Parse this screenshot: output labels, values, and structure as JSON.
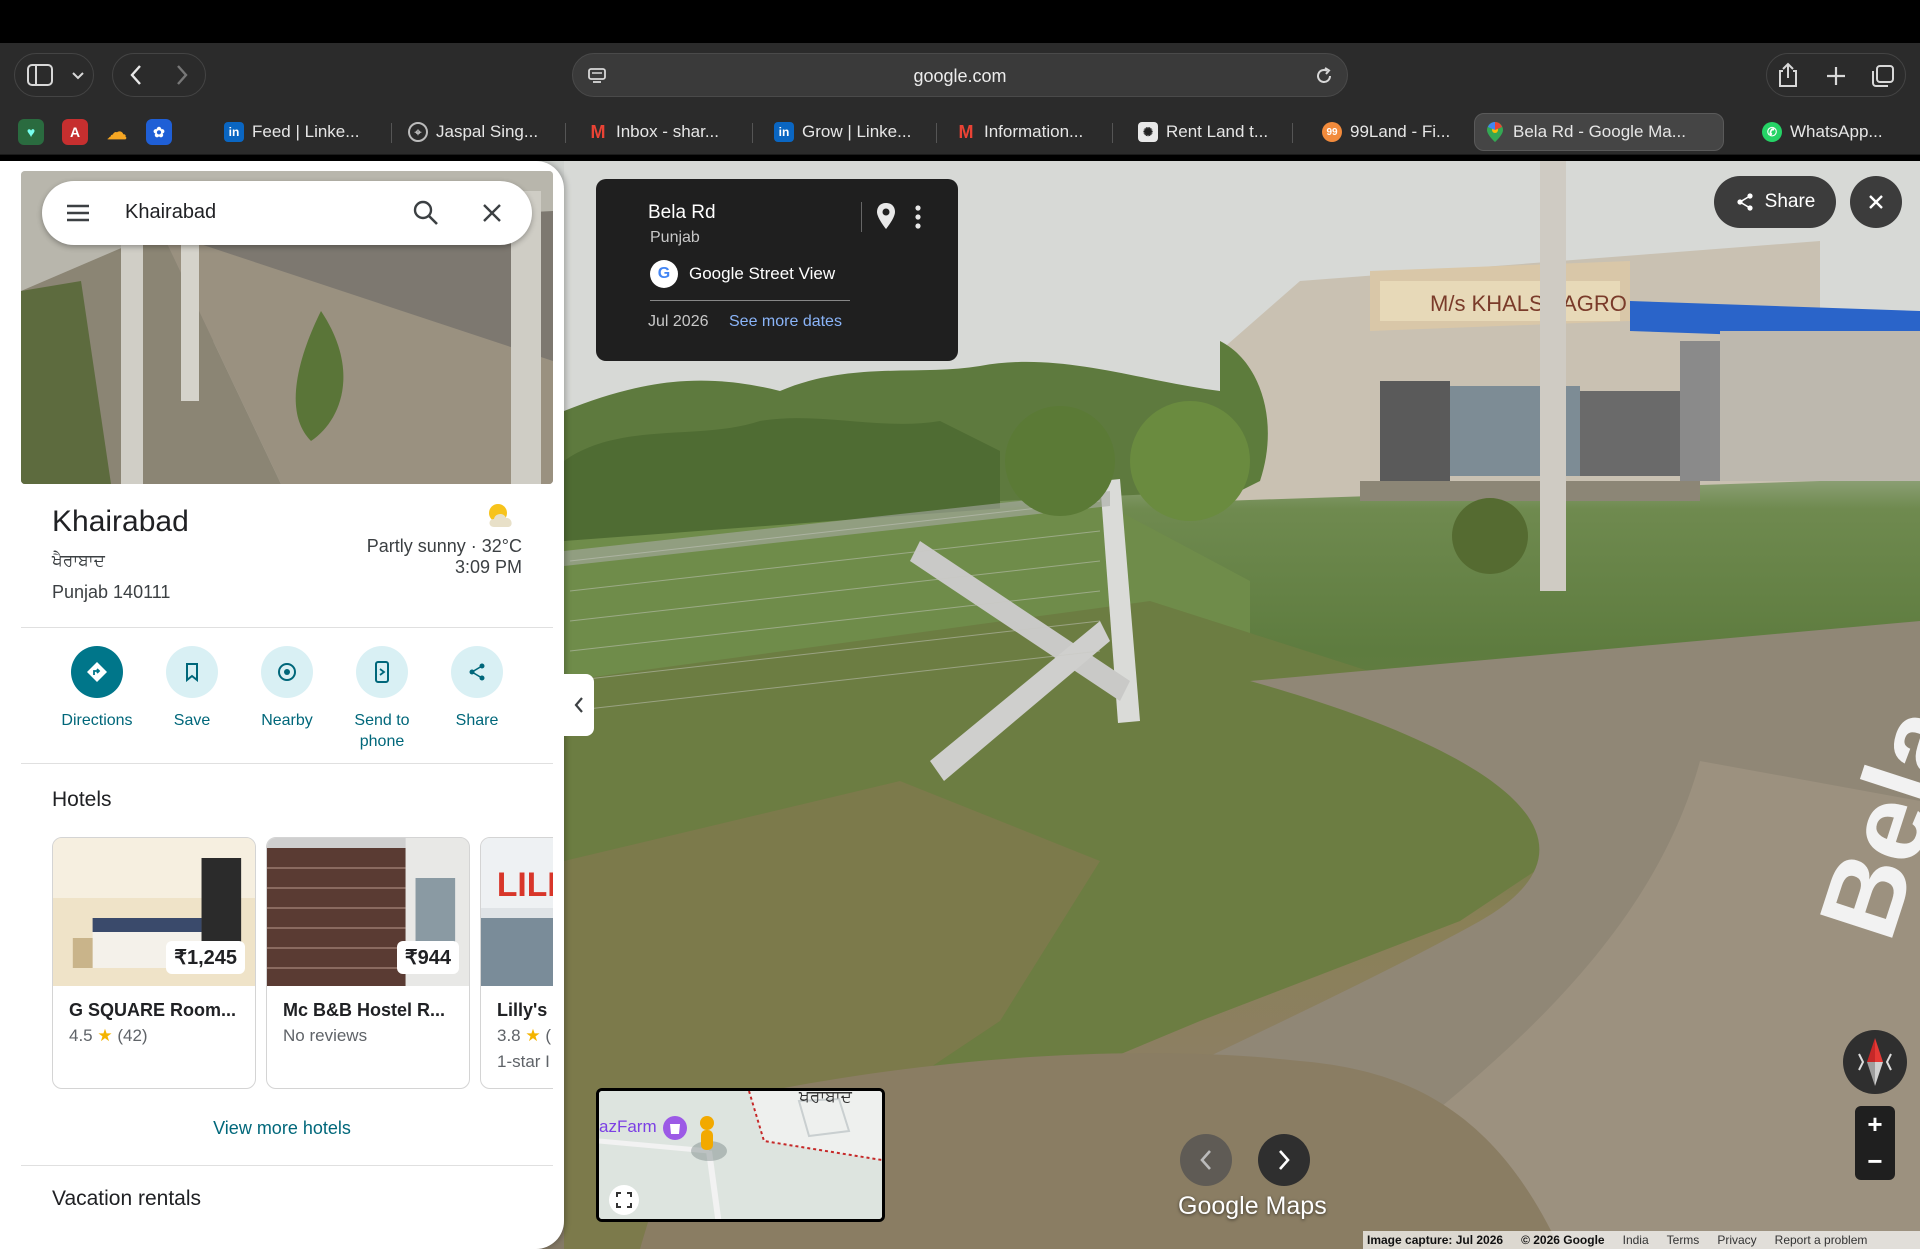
{
  "browser": {
    "address": "google.com",
    "tabs": [
      {
        "label": "Feed | Linke...",
        "icon": "linkedin-icon",
        "color": "#0a66c2"
      },
      {
        "label": "Jaspal Sing...",
        "icon": "compass-icon",
        "color": "#9aa0a6"
      },
      {
        "label": "Inbox - shar...",
        "icon": "gmail-icon",
        "color": "#ea4335"
      },
      {
        "label": "Grow | Linke...",
        "icon": "linkedin-icon",
        "color": "#0a66c2"
      },
      {
        "label": "Information...",
        "icon": "gmail-icon",
        "color": "#ea4335"
      },
      {
        "label": "Rent Land t...",
        "icon": "openai-icon",
        "color": "#e8e8e8"
      },
      {
        "label": "99Land - Fi...",
        "icon": "99land-icon",
        "color": "#f28b3c"
      },
      {
        "label": "Bela Rd - Google Ma...",
        "icon": "maps-pin-icon",
        "color": "#34a853",
        "active": true
      },
      {
        "label": "WhatsApp...",
        "icon": "whatsapp-icon",
        "color": "#25d366"
      }
    ]
  },
  "panel": {
    "search_value": "Khairabad",
    "place": {
      "title": "Khairabad",
      "local_name": "ਖੈਰਾਬਾਦ",
      "address": "Punjab 140111",
      "weather": "Partly sunny · 32°C",
      "time": "3:09 PM"
    },
    "actions": [
      "Directions",
      "Save",
      "Nearby",
      "Send to phone",
      "Share"
    ],
    "hotels_title": "Hotels",
    "hotels": [
      {
        "price": "₹1,245",
        "name": "G SQUARE Room...",
        "rating": "4.5",
        "reviews": "(42)",
        "sub": ""
      },
      {
        "price": "₹944",
        "name": "Mc B&B Hostel R...",
        "rating": "",
        "reviews": "No reviews",
        "sub": ""
      },
      {
        "price": "",
        "name": "Lilly's I",
        "rating": "3.8",
        "reviews": "(",
        "sub": "1-star I"
      }
    ],
    "view_more": "View more hotels",
    "vacation_title": "Vacation rentals"
  },
  "infocard": {
    "title": "Bela Rd",
    "subtitle": "Punjab",
    "source": "Google Street View",
    "date": "Jul 2026",
    "more_dates": "See more dates"
  },
  "streetview": {
    "share_label": "Share",
    "logo": "Google Maps",
    "minimap_labels": [
      "azFarm",
      "ਖਰਾਬਾਦ"
    ],
    "footer": {
      "capture": "Image capture: Jul 2026",
      "copyright": "© 2026 Google",
      "links": [
        "India",
        "Terms",
        "Privacy",
        "Report a problem"
      ]
    }
  }
}
